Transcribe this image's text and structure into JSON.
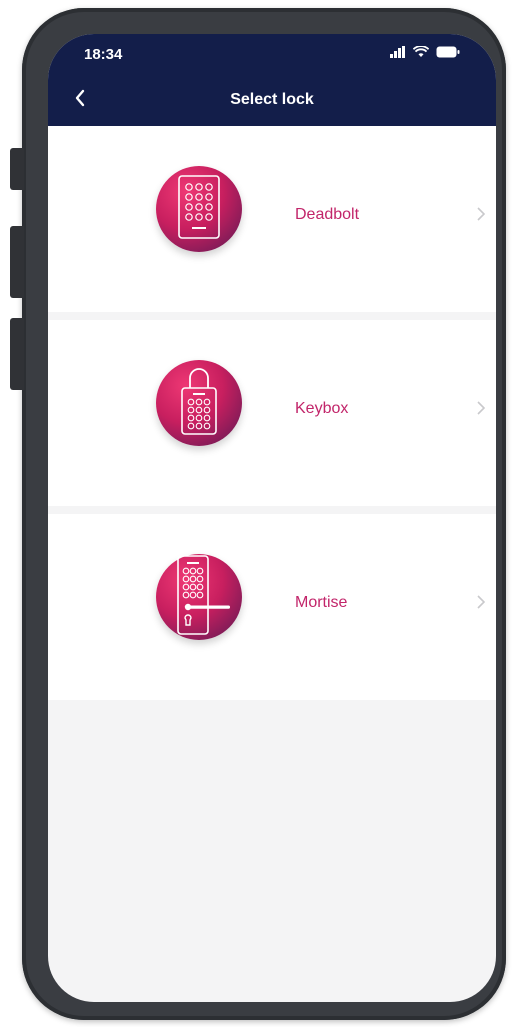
{
  "status": {
    "time": "18:34",
    "signal_icon": "signal-icon",
    "wifi_icon": "wifi-icon",
    "battery_icon": "battery-icon"
  },
  "header": {
    "title": "Select lock",
    "back_icon": "chevron-left-icon"
  },
  "locks": [
    {
      "label": "Deadbolt",
      "icon": "deadbolt-lock-icon"
    },
    {
      "label": "Keybox",
      "icon": "keybox-lock-icon"
    },
    {
      "label": "Mortise",
      "icon": "mortise-lock-icon"
    }
  ],
  "colors": {
    "header_bg": "#131e4a",
    "accent": "#c2256a",
    "badge_gradient_start": "#ee3874",
    "badge_gradient_end": "#5a1a54"
  }
}
